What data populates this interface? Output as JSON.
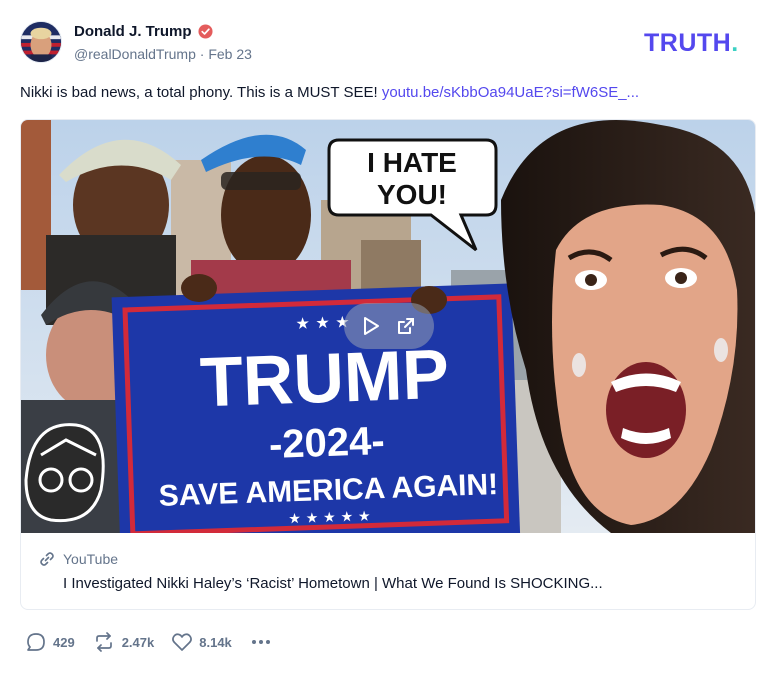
{
  "post": {
    "author_name": "Donald J. Trump",
    "handle": "@realDonaldTrump",
    "separator": "·",
    "date": "Feb 23",
    "text": "Nikki is bad news, a total phony. This is a MUST SEE!",
    "link_text": "youtu.be/sKbbOa94UaE?si=fW6SE_..."
  },
  "brand": {
    "logo_text": "TRUTH",
    "logo_dot": ".",
    "colors": {
      "primary": "#5448ee",
      "accent": "#3bd1c3"
    }
  },
  "link_card": {
    "provider": "YouTube",
    "title": "I Investigated Nikki Haley’s ‘Racist’ Hometown | What We Found Is SHOCKING...",
    "thumbnail": {
      "speech_bubble": [
        "I HATE",
        "YOU!"
      ],
      "sign_line_1": "TRUMP",
      "sign_line_2": "-2024-",
      "sign_line_3": "SAVE AMERICA AGAIN!",
      "sign_stars_top": "★ ★ ★",
      "sign_stars_bottom": "★ ★ ★ ★ ★"
    }
  },
  "actions": {
    "replies": "429",
    "retruths": "2.47k",
    "likes": "8.14k"
  },
  "icons": [
    "verified-icon",
    "link-icon",
    "play-icon",
    "external-link-icon",
    "reply-icon",
    "retruth-icon",
    "like-icon",
    "more-icon"
  ]
}
